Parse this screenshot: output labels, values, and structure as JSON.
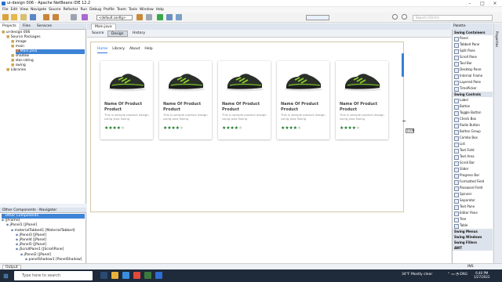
{
  "window": {
    "title": "ui-design 006 - Apache NetBeans IDE 12.2"
  },
  "menu": [
    "File",
    "Edit",
    "View",
    "Navigate",
    "Source",
    "Refactor",
    "Run",
    "Debug",
    "Profile",
    "Team",
    "Tools",
    "Window",
    "Help"
  ],
  "toolbar": {
    "config": "<default config>",
    "memory": "",
    "search_placeholder": "Search (Ctrl+I)"
  },
  "left_tabs": [
    "Projects",
    "Files",
    "Services"
  ],
  "project_tree": [
    {
      "label": "ui-design 006",
      "depth": 0,
      "selected": false
    },
    {
      "label": "Source Packages",
      "depth": 1,
      "selected": false
    },
    {
      "label": "image",
      "depth": 2,
      "selected": false
    },
    {
      "label": "main",
      "depth": 2,
      "selected": false
    },
    {
      "label": "Main.java",
      "depth": 3,
      "selected": true
    },
    {
      "label": "shadow",
      "depth": 2,
      "selected": false
    },
    {
      "label": "star.rating",
      "depth": 2,
      "selected": false
    },
    {
      "label": "swing",
      "depth": 2,
      "selected": false
    },
    {
      "label": "Libraries",
      "depth": 1,
      "selected": false
    }
  ],
  "navigator": {
    "title": "Other Components - Navigator",
    "items": [
      {
        "label": "Other Components",
        "depth": 0,
        "selected": true
      },
      {
        "label": "[JFrame]",
        "depth": 0,
        "selected": false
      },
      {
        "label": "jPanel1 [JPanel]",
        "depth": 1,
        "selected": false
      },
      {
        "label": "materialTabbed1 [MaterialTabbed]",
        "depth": 2,
        "selected": false
      },
      {
        "label": "jPanel3 [JPanel]",
        "depth": 3,
        "selected": false
      },
      {
        "label": "jPanel4 [JPanel]",
        "depth": 3,
        "selected": false
      },
      {
        "label": "jPanel5 [JPanel]",
        "depth": 3,
        "selected": false
      },
      {
        "label": "jScrollPane1 [JScrollPane]",
        "depth": 3,
        "selected": false
      },
      {
        "label": "jPanel2 [JPanel]",
        "depth": 4,
        "selected": false
      },
      {
        "label": "panelShadow1 [PanelShadow]",
        "depth": 5,
        "selected": false
      }
    ]
  },
  "editor": {
    "file_tab": "Main.java",
    "subtabs": [
      "Source",
      "Design",
      "History"
    ],
    "size_tooltip": "1108"
  },
  "app_nav": [
    "Home",
    "Library",
    "About",
    "Help"
  ],
  "cards": [
    {
      "name": "Name Of Product Product",
      "desc": "This is sample product design using java Swing",
      "rating": 4
    },
    {
      "name": "Name Of Product Product",
      "desc": "This is sample product design using java Swing",
      "rating": 4
    },
    {
      "name": "Name Of Product Product",
      "desc": "This is sample product design using java Swing",
      "rating": 4
    },
    {
      "name": "Name Of Product Product",
      "desc": "This is sample product design using java Swing",
      "rating": 4
    },
    {
      "name": "Name Of Product Product",
      "desc": "This is sample product design using java Swing",
      "rating": 4
    }
  ],
  "palette": {
    "title": "Palette",
    "groups": [
      {
        "title": "Swing Containers",
        "items": [
          "Panel",
          "Tabbed Pane",
          "Split Pane",
          "Scroll Pane",
          "Tool Bar",
          "Desktop Pane",
          "Internal Frame",
          "Layered Pane",
          "TimePicker"
        ]
      },
      {
        "title": "Swing Controls",
        "items": [
          "Label",
          "Button",
          "Toggle Button",
          "Check Box",
          "Radio Button",
          "Button Group",
          "Combo Box",
          "List",
          "Text Field",
          "Text Area",
          "Scroll Bar",
          "Slider",
          "Progress Bar",
          "Formatted Field",
          "Password Field",
          "Spinner",
          "Separator",
          "Text Pane",
          "Editor Pane",
          "Tree",
          "Table"
        ]
      },
      {
        "title": "Swing Menus",
        "items": []
      },
      {
        "title": "Swing Windows",
        "items": []
      },
      {
        "title": "Swing Fillers",
        "items": []
      },
      {
        "title": "AWT",
        "items": []
      }
    ],
    "side_label": "Properties"
  },
  "status": {
    "output": "Output",
    "ins": "INS"
  },
  "taskbar": {
    "search": "Type here to search",
    "weather": "34°F  Mostly clear",
    "time": "6:40 PM",
    "date": "1/27/2022"
  },
  "colors": {
    "accent": "#3b7fd4",
    "star": "#1f7a2a",
    "taskbar": "#1f2a3a"
  }
}
